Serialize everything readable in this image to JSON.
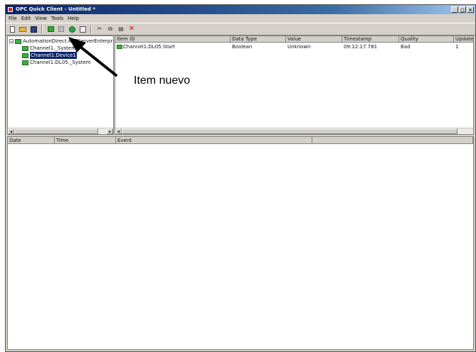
{
  "window": {
    "title": "OPC Quick Client - Untitled *",
    "controls": [
      "_",
      "□",
      "×"
    ]
  },
  "menu": [
    "File",
    "Edit",
    "View",
    "Tools",
    "Help"
  ],
  "toolbar": {
    "buttons": [
      "new",
      "open",
      "save",
      "new-server",
      "new-group",
      "new-item",
      "properties",
      "cut",
      "copy",
      "paste",
      "delete"
    ],
    "glyphs": {
      "cut": "✂",
      "copy": "⧉",
      "paste": "▤",
      "delete": "✕"
    }
  },
  "tree": {
    "root": "AutomationDirect.KEPServerEnterprise",
    "root_expander": "−",
    "children": [
      "Channel1._System",
      "Channel1.Device1",
      "Channel1.DL05._System"
    ],
    "selected_index": 1
  },
  "items": {
    "columns": [
      "Item ID",
      "Data Type",
      "Value",
      "Timestamp",
      "Quality",
      "Update Count"
    ],
    "rows": [
      {
        "item_id": "Channel1.DL05.Start",
        "data_type": "Boolean",
        "value": "Unknown",
        "timestamp": "09:12:17.781",
        "quality": "Bad",
        "update_count": "1"
      }
    ]
  },
  "log": {
    "columns": [
      "Date",
      "Time",
      "Event"
    ]
  },
  "annotation": {
    "label": "Item nuevo"
  }
}
